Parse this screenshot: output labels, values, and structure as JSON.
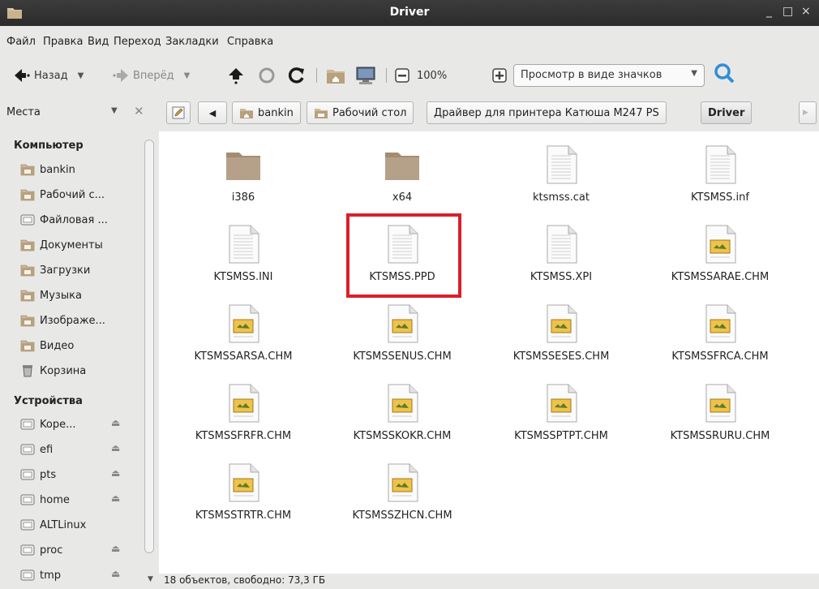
{
  "window": {
    "title": "Driver",
    "minimize": "_",
    "maximize": "□",
    "close": "×"
  },
  "menu": [
    "Файл",
    "Правка",
    "Вид",
    "Переход",
    "Закладки",
    "Справка"
  ],
  "toolbar": {
    "back_label": "Назад",
    "forward_label": "Вперёд",
    "zoom": "100%",
    "view_mode": "Просмотр в виде значков",
    "icons": [
      "back-arrow-icon",
      "forward-arrow-icon",
      "up-arrow-icon",
      "stop-icon",
      "reload-icon",
      "home-folder-icon",
      "computer-icon",
      "zoom-out-icon",
      "zoom-in-icon",
      "search-icon"
    ]
  },
  "places_label": "Места",
  "breadcrumbs": [
    "bankin",
    "Рабочий стол",
    "Драйвер для принтера Катюша M247 PS",
    "Driver"
  ],
  "sidebar": {
    "computer_header": "Компьютер",
    "computer_items": [
      {
        "label": "bankin",
        "icon": "home-folder-icon"
      },
      {
        "label": "Рабочий с...",
        "icon": "desktop-folder-icon"
      },
      {
        "label": "Файловая ...",
        "icon": "drive-icon"
      },
      {
        "label": "Документы",
        "icon": "documents-folder-icon"
      },
      {
        "label": "Загрузки",
        "icon": "downloads-folder-icon"
      },
      {
        "label": "Музыка",
        "icon": "music-folder-icon"
      },
      {
        "label": "Изображе...",
        "icon": "pictures-folder-icon"
      },
      {
        "label": "Видео",
        "icon": "video-folder-icon"
      },
      {
        "label": "Корзина",
        "icon": "trash-icon"
      }
    ],
    "devices_header": "Устройства",
    "device_items": [
      {
        "label": "Kope...",
        "eject": "⏏"
      },
      {
        "label": "efi",
        "eject": "⏏"
      },
      {
        "label": "pts",
        "eject": "⏏"
      },
      {
        "label": "home",
        "eject": "⏏"
      },
      {
        "label": "ALTLinux",
        "eject": ""
      },
      {
        "label": "proc",
        "eject": "⏏"
      },
      {
        "label": "tmp",
        "eject": "⏏"
      }
    ]
  },
  "files": [
    {
      "name": "i386",
      "type": "folder"
    },
    {
      "name": "x64",
      "type": "folder"
    },
    {
      "name": "ktsmss.cat",
      "type": "text"
    },
    {
      "name": "KTSMSS.inf",
      "type": "text"
    },
    {
      "name": "KTSMSS.INI",
      "type": "text"
    },
    {
      "name": "KTSMSS.PPD",
      "type": "text",
      "highlighted": true
    },
    {
      "name": "KTSMSS.XPI",
      "type": "text"
    },
    {
      "name": "KTSMSSARAE.CHM",
      "type": "chm"
    },
    {
      "name": "KTSMSSARSA.CHM",
      "type": "chm"
    },
    {
      "name": "KTSMSSENUS.CHM",
      "type": "chm"
    },
    {
      "name": "KTSMSSESES.CHM",
      "type": "chm"
    },
    {
      "name": "KTSMSSFRCA.CHM",
      "type": "chm"
    },
    {
      "name": "KTSMSSFRFR.CHM",
      "type": "chm"
    },
    {
      "name": "KTSMSSKOKR.CHM",
      "type": "chm"
    },
    {
      "name": "KTSMSSPTPT.CHM",
      "type": "chm"
    },
    {
      "name": "KTSMSSRURU.CHM",
      "type": "chm"
    },
    {
      "name": "KTSMSSTRTR.CHM",
      "type": "chm"
    },
    {
      "name": "KTSMSSZHCN.CHM",
      "type": "chm"
    }
  ],
  "status": "18 объектов, свободно: 73,3 ГБ",
  "colors": {
    "highlight": "#d9202b",
    "folder": "#b5a189",
    "search": "#2f8fd8"
  }
}
